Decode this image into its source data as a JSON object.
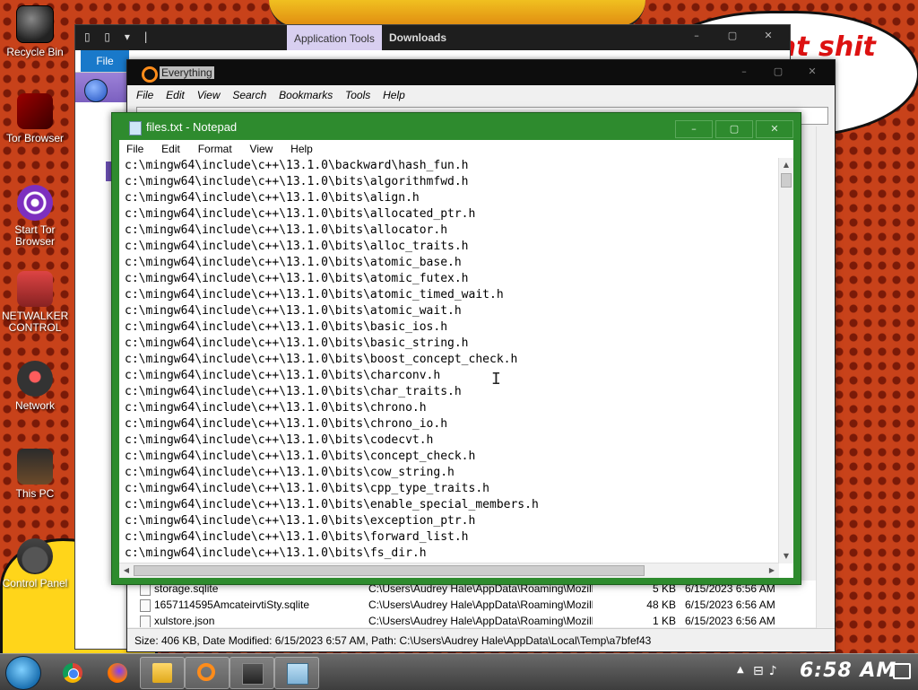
{
  "desktop": {
    "background_text": "at shit\nw",
    "icons": [
      {
        "label": "Recycle Bin"
      },
      {
        "label": "Tor Browser"
      },
      {
        "label": "Start Tor Browser"
      },
      {
        "label": "NETWALKER CONTROL"
      },
      {
        "label": "Network"
      },
      {
        "label": "This PC"
      },
      {
        "label": "Control Panel"
      }
    ]
  },
  "explorer": {
    "context_tab": "Application Tools",
    "title": "Downloads",
    "file_tab": "File",
    "quick_access": "▯ ▯ ▾ |"
  },
  "everything": {
    "title": "Everything",
    "menu": [
      "File",
      "Edit",
      "View",
      "Search",
      "Bookmarks",
      "Tools",
      "Help"
    ],
    "search_value": "",
    "results": [
      {
        "name": "storage.sqlite",
        "path": "C:\\Users\\Audrey Hale\\AppData\\Roaming\\Mozilla...",
        "size": "5 KB",
        "date": "6/15/2023 6:56 AM"
      },
      {
        "name": "1657114595AmcateirvtiSty.sqlite",
        "path": "C:\\Users\\Audrey Hale\\AppData\\Roaming\\Mozilla...",
        "size": "48 KB",
        "date": "6/15/2023 6:56 AM"
      },
      {
        "name": "xulstore.json",
        "path": "C:\\Users\\Audrey Hale\\AppData\\Roaming\\Mozilla...",
        "size": "1 KB",
        "date": "6/15/2023 6:56 AM"
      }
    ],
    "status": "Size: 406 KB, Date Modified: 6/15/2023 6:57 AM, Path: C:\\Users\\Audrey Hale\\AppData\\Local\\Temp\\a7bfef43"
  },
  "notepad": {
    "title": "files.txt - Notepad",
    "menu": [
      "File",
      "Edit",
      "Format",
      "View",
      "Help"
    ],
    "lines": [
      "c:\\mingw64\\include\\c++\\13.1.0\\backward\\hash_fun.h",
      "c:\\mingw64\\include\\c++\\13.1.0\\bits\\algorithmfwd.h",
      "c:\\mingw64\\include\\c++\\13.1.0\\bits\\align.h",
      "c:\\mingw64\\include\\c++\\13.1.0\\bits\\allocated_ptr.h",
      "c:\\mingw64\\include\\c++\\13.1.0\\bits\\allocator.h",
      "c:\\mingw64\\include\\c++\\13.1.0\\bits\\alloc_traits.h",
      "c:\\mingw64\\include\\c++\\13.1.0\\bits\\atomic_base.h",
      "c:\\mingw64\\include\\c++\\13.1.0\\bits\\atomic_futex.h",
      "c:\\mingw64\\include\\c++\\13.1.0\\bits\\atomic_timed_wait.h",
      "c:\\mingw64\\include\\c++\\13.1.0\\bits\\atomic_wait.h",
      "c:\\mingw64\\include\\c++\\13.1.0\\bits\\basic_ios.h",
      "c:\\mingw64\\include\\c++\\13.1.0\\bits\\basic_string.h",
      "c:\\mingw64\\include\\c++\\13.1.0\\bits\\boost_concept_check.h",
      "c:\\mingw64\\include\\c++\\13.1.0\\bits\\charconv.h",
      "c:\\mingw64\\include\\c++\\13.1.0\\bits\\char_traits.h",
      "c:\\mingw64\\include\\c++\\13.1.0\\bits\\chrono.h",
      "c:\\mingw64\\include\\c++\\13.1.0\\bits\\chrono_io.h",
      "c:\\mingw64\\include\\c++\\13.1.0\\bits\\codecvt.h",
      "c:\\mingw64\\include\\c++\\13.1.0\\bits\\concept_check.h",
      "c:\\mingw64\\include\\c++\\13.1.0\\bits\\cow_string.h",
      "c:\\mingw64\\include\\c++\\13.1.0\\bits\\cpp_type_traits.h",
      "c:\\mingw64\\include\\c++\\13.1.0\\bits\\enable_special_members.h",
      "c:\\mingw64\\include\\c++\\13.1.0\\bits\\exception_ptr.h",
      "c:\\mingw64\\include\\c++\\13.1.0\\bits\\forward_list.h",
      "c:\\mingw64\\include\\c++\\13.1.0\\bits\\fs_dir.h"
    ]
  },
  "taskbar": {
    "clock": "6:58 AM",
    "apps": [
      "chrome",
      "firefox",
      "file-explorer",
      "everything",
      "app",
      "notepad"
    ]
  }
}
